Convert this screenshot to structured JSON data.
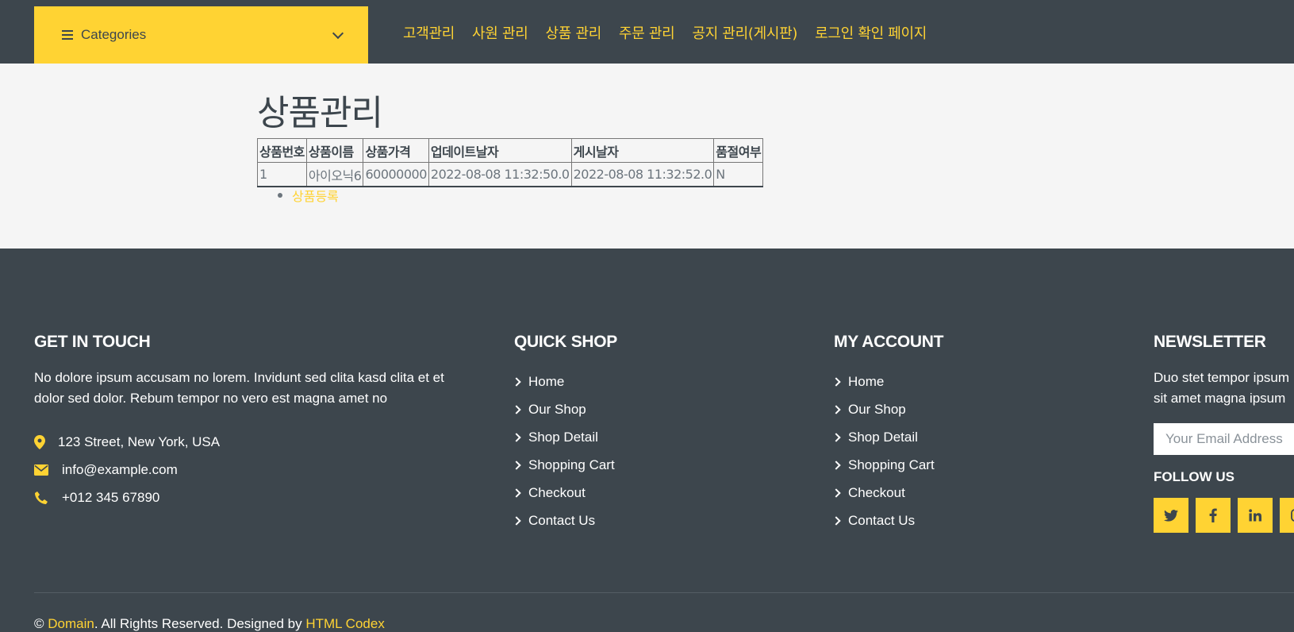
{
  "navbar": {
    "categories_label": "Categories",
    "links": [
      "고객관리",
      "사원 관리",
      "상품 관리",
      "주문 관리",
      "공지 관리(게시판)",
      "로그인 확인 페이지"
    ]
  },
  "main": {
    "title": "상품관리",
    "table": {
      "headers": [
        "상품번호",
        "상품이름",
        "상품가격",
        "업데이트날자",
        "게시날자",
        "품절여부"
      ],
      "rows": [
        [
          "1",
          "아이오닉6",
          "60000000",
          "2022-08-08 11:32:50.0",
          "2022-08-08 11:32:52.0",
          "N"
        ]
      ]
    },
    "register_link": "상품등록"
  },
  "footer": {
    "get_in_touch": {
      "heading": "GET IN TOUCH",
      "text": "No dolore ipsum accusam no lorem. Invidunt sed clita kasd clita et et dolor sed dolor. Rebum tempor no vero est magna amet no",
      "address": "123 Street, New York, USA",
      "email": "info@example.com",
      "phone": "+012 345 67890"
    },
    "quick_shop": {
      "heading": "QUICK SHOP",
      "links": [
        "Home",
        "Our Shop",
        "Shop Detail",
        "Shopping Cart",
        "Checkout",
        "Contact Us"
      ]
    },
    "my_account": {
      "heading": "MY ACCOUNT",
      "links": [
        "Home",
        "Our Shop",
        "Shop Detail",
        "Shopping Cart",
        "Checkout",
        "Contact Us"
      ]
    },
    "newsletter": {
      "heading": "NEWSLETTER",
      "text": "Duo stet tempor ipsum sit amet magna ipsum tempor est",
      "email_placeholder": "Your Email Address",
      "follow_label": "FOLLOW US",
      "social_icons": [
        "twitter-icon",
        "facebook-icon",
        "linkedin-icon",
        "instagram-icon"
      ]
    },
    "copyright": {
      "prefix": "© ",
      "domain": "Domain",
      "middle": ". All Rights Reserved. Designed by ",
      "designer": "HTML Codex"
    }
  },
  "colors": {
    "accent": "#ffd333",
    "dark": "#3d464d",
    "light_bg": "#f5f5f5"
  }
}
